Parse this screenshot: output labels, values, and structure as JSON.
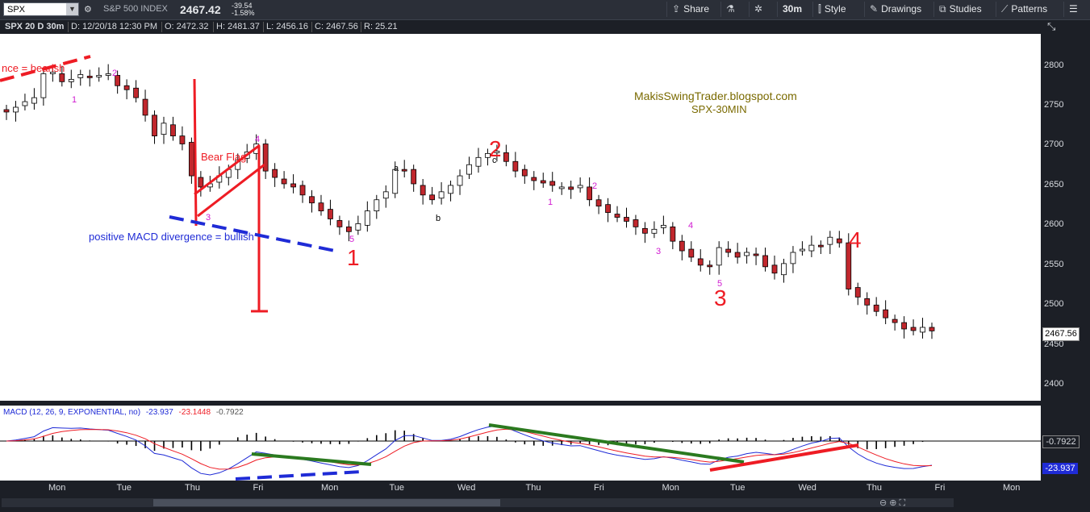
{
  "toolbar": {
    "symbol": "SPX",
    "symbol_desc": "S&P 500 INDEX",
    "last_price": "2467.42",
    "net_change": "-39.54",
    "pct_change": "-1.58%",
    "share": "Share",
    "interval": "30m",
    "style": "Style",
    "drawings": "Drawings",
    "studies": "Studies",
    "patterns": "Patterns"
  },
  "info_bar": {
    "title": "SPX 20 D 30m",
    "date": "D: 12/20/18 12:30 PM",
    "open": "O: 2472.32",
    "high": "H: 2481.37",
    "low": "L: 2456.16",
    "close": "C: 2467.56",
    "range": "R: 25.21"
  },
  "annotations": {
    "watermark_line1": "MakisSwingTrader.blogspot.com",
    "watermark_line2": "SPX-30MIN",
    "bear_flag": "Bear Flag",
    "pos_macd_div": "positive MACD divergence = bullish",
    "neg_macd_div": "nce = bearish",
    "wave_1": "1",
    "wave_2": "2",
    "wave_3": "3",
    "wave_4": "4",
    "sub_a": "a",
    "sub_b": "b",
    "sub_c": "c",
    "sub_labels": [
      {
        "t": "1"
      },
      {
        "t": "2"
      },
      {
        "t": "3"
      },
      {
        "t": "4"
      },
      {
        "t": "5"
      },
      {
        "t": "1"
      },
      {
        "t": "2"
      },
      {
        "t": "3"
      },
      {
        "t": "4"
      },
      {
        "t": "5"
      }
    ]
  },
  "macd": {
    "legend_name": "MACD (12, 26, 9, EXPONENTIAL, no)",
    "value": "-23.937",
    "avg": "-23.1448",
    "diff": "-0.7922",
    "axis_zero_label": "-0.7922",
    "axis_value_label": "-23.937"
  },
  "chart_data": {
    "type": "candlestick",
    "title": "SPX 20 D 30m",
    "ylim": [
      2380,
      2840
    ],
    "y_ticks": [
      2400,
      2450,
      2500,
      2550,
      2600,
      2650,
      2700,
      2750,
      2800
    ],
    "x_tick_labels": [
      "Mon",
      "Tue",
      "Thu",
      "Fri",
      "Mon",
      "Tue",
      "Wed",
      "Thu",
      "Fri",
      "Mon",
      "Tue",
      "Wed",
      "Thu",
      "Fri",
      "Mon"
    ],
    "last_price_label": "2467.56",
    "close_path": [
      2742,
      2748,
      2755,
      2760,
      2790,
      2792,
      2780,
      2783,
      2789,
      2786,
      2788,
      2790,
      2775,
      2770,
      2760,
      2738,
      2712,
      2728,
      2712,
      2702,
      2662,
      2648,
      2652,
      2662,
      2670,
      2682,
      2692,
      2702,
      2668,
      2660,
      2652,
      2648,
      2638,
      2628,
      2618,
      2608,
      2598,
      2592,
      2602,
      2618,
      2632,
      2642,
      2670,
      2668,
      2652,
      2638,
      2632,
      2642,
      2650,
      2662,
      2676,
      2685,
      2690,
      2693,
      2680,
      2668,
      2662,
      2656,
      2653,
      2650,
      2648,
      2645,
      2650,
      2632,
      2624,
      2616,
      2610,
      2605,
      2598,
      2590,
      2595,
      2600,
      2580,
      2568,
      2560,
      2550,
      2548,
      2572,
      2566,
      2560,
      2566,
      2562,
      2548,
      2540,
      2552,
      2566,
      2570,
      2575,
      2574,
      2585,
      2578,
      2520,
      2510,
      2500,
      2492,
      2484,
      2478,
      2470,
      2468,
      2472,
      2467.56
    ]
  }
}
